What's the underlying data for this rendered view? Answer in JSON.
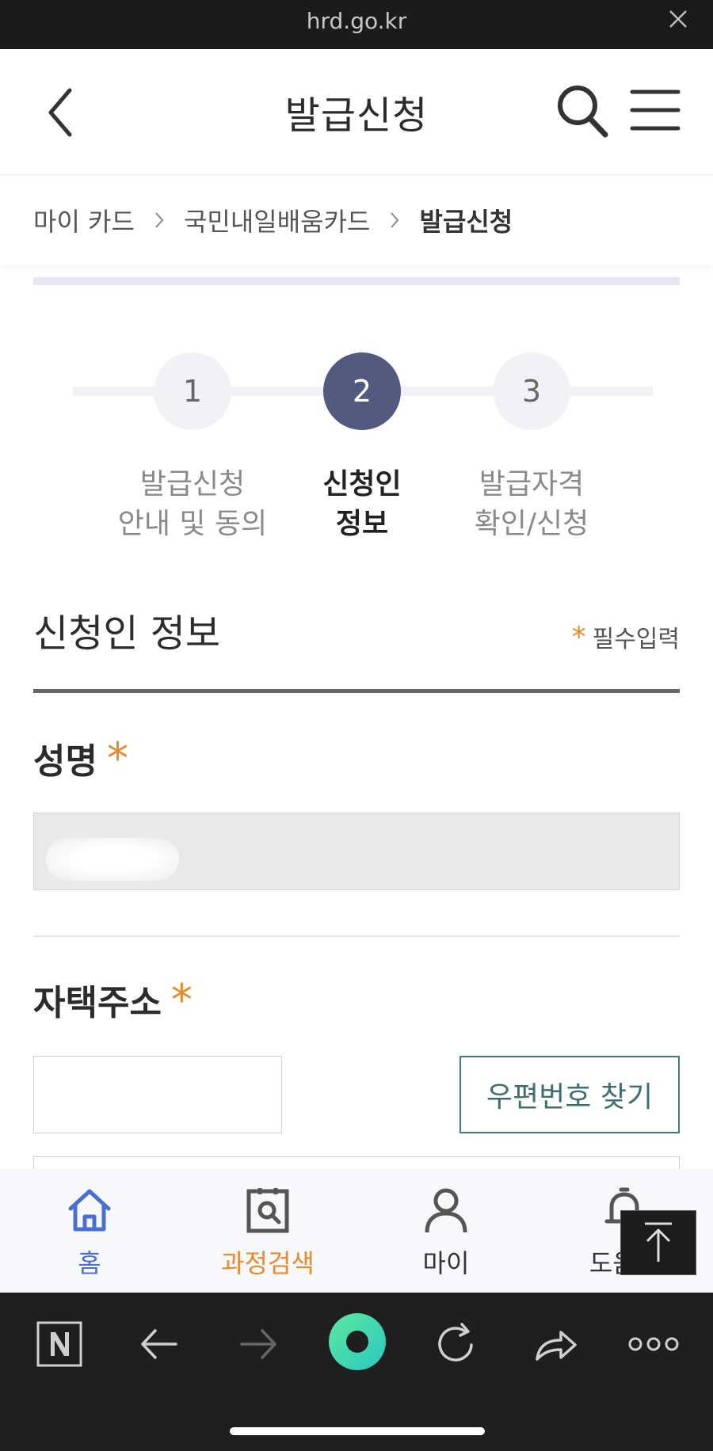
{
  "browser": {
    "url": "hrd.go.kr"
  },
  "header": {
    "title": "발급신청"
  },
  "breadcrumb": {
    "items": [
      "마이 카드",
      "국민내일배움카드"
    ],
    "current": "발급신청"
  },
  "steps": [
    {
      "number": "1",
      "line1": "발급신청",
      "line2": "안내 및 동의",
      "active": false
    },
    {
      "number": "2",
      "line1": "신청인",
      "line2": "정보",
      "active": true
    },
    {
      "number": "3",
      "line1": "발급자격",
      "line2": "확인/신청",
      "active": false
    }
  ],
  "form": {
    "section_title": "신청인 정보",
    "required_mark": "*",
    "required_note": "필수입력",
    "name_label": "성명",
    "name_value": "",
    "address_label": "자택주소",
    "zip_value": "",
    "zip_button": "우편번호 찾기"
  },
  "bottom_nav": {
    "items": [
      {
        "label": "홈",
        "icon": "home-icon"
      },
      {
        "label": "과정검색",
        "icon": "course-search-icon"
      },
      {
        "label": "마이",
        "icon": "user-icon"
      },
      {
        "label": "도움말",
        "icon": "bell-icon"
      }
    ]
  },
  "colors": {
    "accent_orange": "#e98b2a",
    "step_active": "#525a7f",
    "home_blue": "#4b6fd1",
    "zip_button_border": "#3f7c78"
  }
}
